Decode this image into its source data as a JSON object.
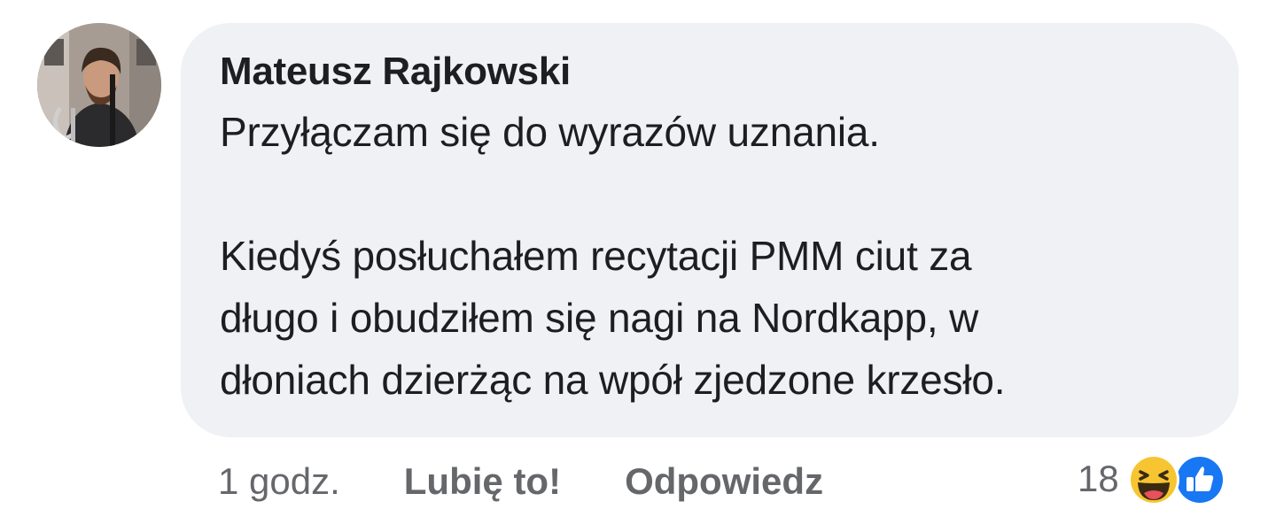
{
  "comment": {
    "author": "Mateusz Rajkowski",
    "text": "Przyłączam się do wyrazów uznania.\n\nKiedyś posłuchałem recytacji PMM ciut za\ndługo i obudziłem się nagi na Nordkapp, w\ndłoniach dzierżąc na wpół zjedzone krzesło."
  },
  "actions": {
    "time": "1 godz.",
    "like_label": "Lubię to!",
    "reply_label": "Odpowiedz"
  },
  "reactions": {
    "count": "18",
    "icons": [
      "haha-icon",
      "like-icon"
    ]
  },
  "colors": {
    "bubble": "#f0f1f5",
    "text": "#1c1e21",
    "secondary": "#65676b",
    "like_blue": "#1877f2",
    "haha_yellow": "#f7c531"
  }
}
